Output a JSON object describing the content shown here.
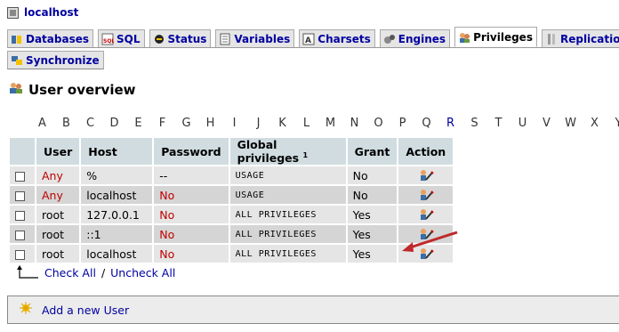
{
  "server": {
    "label": "localhost"
  },
  "tabs_row1": [
    {
      "label": "Databases",
      "icon": "databases-icon"
    },
    {
      "label": "SQL",
      "icon": "sql-icon"
    },
    {
      "label": "Status",
      "icon": "status-icon"
    },
    {
      "label": "Variables",
      "icon": "variables-icon"
    },
    {
      "label": "Charsets",
      "icon": "charsets-icon"
    },
    {
      "label": "Engines",
      "icon": "engines-icon"
    },
    {
      "label": "Privileges",
      "icon": "privileges-icon",
      "active": true
    },
    {
      "label": "Replication",
      "icon": "replication-icon"
    }
  ],
  "tabs_row2": [
    {
      "label": "Synchronize",
      "icon": "synchronize-icon"
    }
  ],
  "section": {
    "title": "User overview"
  },
  "letters": [
    "A",
    "B",
    "C",
    "D",
    "E",
    "F",
    "G",
    "H",
    "I",
    "J",
    "K",
    "L",
    "M",
    "N",
    "O",
    "P",
    "Q",
    "R",
    "S",
    "T",
    "U",
    "V",
    "W",
    "X",
    "Y"
  ],
  "letters_highlight": "R",
  "table": {
    "headers": {
      "user": "User",
      "host": "Host",
      "password": "Password",
      "global": "Global privileges",
      "global_sup": "1",
      "grant": "Grant",
      "action": "Action"
    },
    "rows": [
      {
        "user": "Any",
        "host": "%",
        "password": "--",
        "global": "USAGE",
        "grant": "No"
      },
      {
        "user": "Any",
        "host": "localhost",
        "password": "No",
        "global": "USAGE",
        "grant": "No"
      },
      {
        "user": "root",
        "host": "127.0.0.1",
        "password": "No",
        "global": "ALL PRIVILEGES",
        "grant": "Yes"
      },
      {
        "user": "root",
        "host": "::1",
        "password": "No",
        "global": "ALL PRIVILEGES",
        "grant": "Yes"
      },
      {
        "user": "root",
        "host": "localhost",
        "password": "No",
        "global": "ALL PRIVILEGES",
        "grant": "Yes"
      }
    ]
  },
  "checkall": {
    "check_label": "Check All",
    "separator": "/",
    "uncheck_label": "Uncheck All"
  },
  "add_user": {
    "label": "Add a new User"
  },
  "colors": {
    "link": "#0000a0",
    "red": "#c00000",
    "header_bg": "#d0dce0",
    "arrow": "#c0282a"
  }
}
